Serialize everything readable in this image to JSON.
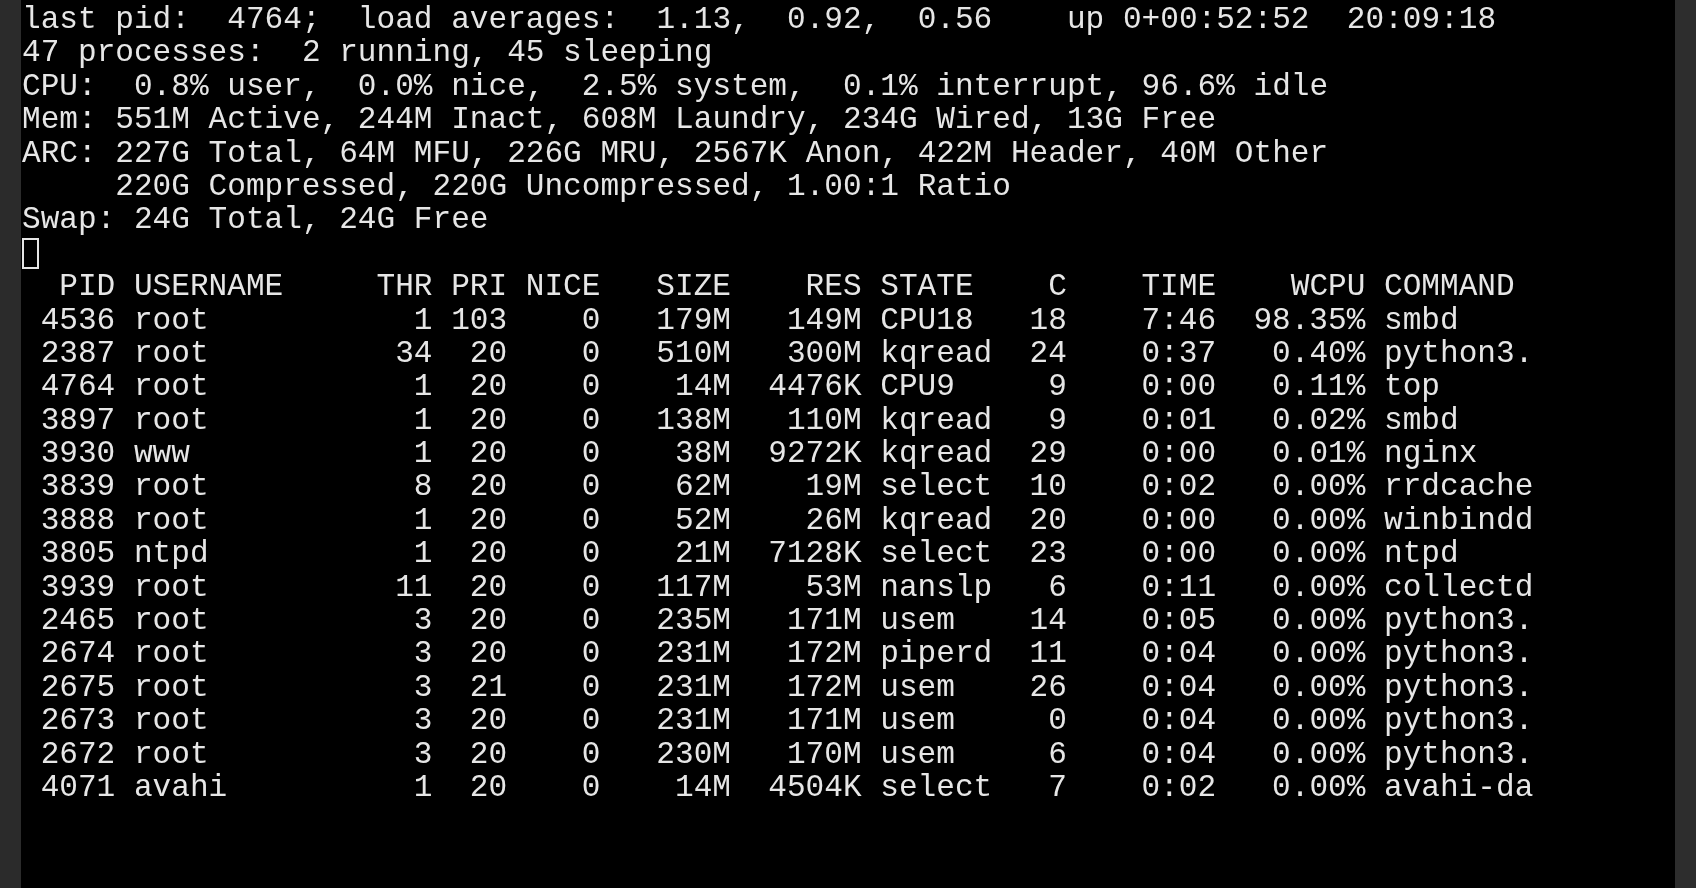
{
  "summary_lines": [
    {
      "text": "last pid:  4764;  load averages:  1.13,  0.92,  0.56    up 0+00:52:52  20:09:18",
      "indent": false
    },
    {
      "text": "47 processes:  2 running, 45 sleeping",
      "indent": false
    },
    {
      "text": "CPU:  0.8% user,  0.0% nice,  2.5% system,  0.1% interrupt, 96.6% idle",
      "indent": false
    },
    {
      "text": "Mem: 551M Active, 244M Inact, 608M Laundry, 234G Wired, 13G Free",
      "indent": false
    },
    {
      "text": "ARC: 227G Total, 64M MFU, 226G MRU, 2567K Anon, 422M Header, 40M Other",
      "indent": false
    },
    {
      "text": "220G Compressed, 220G Uncompressed, 1.00:1 Ratio",
      "indent": true
    },
    {
      "text": "Swap: 24G Total, 24G Free",
      "indent": false
    }
  ],
  "cursor": {
    "visible": true
  },
  "table": {
    "columns": [
      "PID",
      "USERNAME",
      "THR",
      "PRI",
      "NICE",
      "SIZE",
      "RES",
      "STATE",
      "C",
      "TIME",
      "WCPU",
      "COMMAND"
    ],
    "rows": [
      [
        "4536",
        "root",
        "1",
        "103",
        "0",
        "179M",
        "149M",
        "CPU18",
        "18",
        "7:46",
        "98.35%",
        "smbd"
      ],
      [
        "2387",
        "root",
        "34",
        "20",
        "0",
        "510M",
        "300M",
        "kqread",
        "24",
        "0:37",
        "0.40%",
        "python3."
      ],
      [
        "4764",
        "root",
        "1",
        "20",
        "0",
        "14M",
        "4476K",
        "CPU9",
        "9",
        "0:00",
        "0.11%",
        "top"
      ],
      [
        "3897",
        "root",
        "1",
        "20",
        "0",
        "138M",
        "110M",
        "kqread",
        "9",
        "0:01",
        "0.02%",
        "smbd"
      ],
      [
        "3930",
        "www",
        "1",
        "20",
        "0",
        "38M",
        "9272K",
        "kqread",
        "29",
        "0:00",
        "0.01%",
        "nginx"
      ],
      [
        "3839",
        "root",
        "8",
        "20",
        "0",
        "62M",
        "19M",
        "select",
        "10",
        "0:02",
        "0.00%",
        "rrdcache"
      ],
      [
        "3888",
        "root",
        "1",
        "20",
        "0",
        "52M",
        "26M",
        "kqread",
        "20",
        "0:00",
        "0.00%",
        "winbindd"
      ],
      [
        "3805",
        "ntpd",
        "1",
        "20",
        "0",
        "21M",
        "7128K",
        "select",
        "23",
        "0:00",
        "0.00%",
        "ntpd"
      ],
      [
        "3939",
        "root",
        "11",
        "20",
        "0",
        "117M",
        "53M",
        "nanslp",
        "6",
        "0:11",
        "0.00%",
        "collectd"
      ],
      [
        "2465",
        "root",
        "3",
        "20",
        "0",
        "235M",
        "171M",
        "usem",
        "14",
        "0:05",
        "0.00%",
        "python3."
      ],
      [
        "2674",
        "root",
        "3",
        "20",
        "0",
        "231M",
        "172M",
        "piperd",
        "11",
        "0:04",
        "0.00%",
        "python3."
      ],
      [
        "2675",
        "root",
        "3",
        "21",
        "0",
        "231M",
        "172M",
        "usem",
        "26",
        "0:04",
        "0.00%",
        "python3."
      ],
      [
        "2673",
        "root",
        "3",
        "20",
        "0",
        "231M",
        "171M",
        "usem",
        "0",
        "0:04",
        "0.00%",
        "python3."
      ],
      [
        "2672",
        "root",
        "3",
        "20",
        "0",
        "230M",
        "170M",
        "usem",
        "6",
        "0:04",
        "0.00%",
        "python3."
      ],
      [
        "4071",
        "avahi",
        "1",
        "20",
        "0",
        "14M",
        "4504K",
        "select",
        "7",
        "0:02",
        "0.00%",
        "avahi-da"
      ]
    ]
  }
}
